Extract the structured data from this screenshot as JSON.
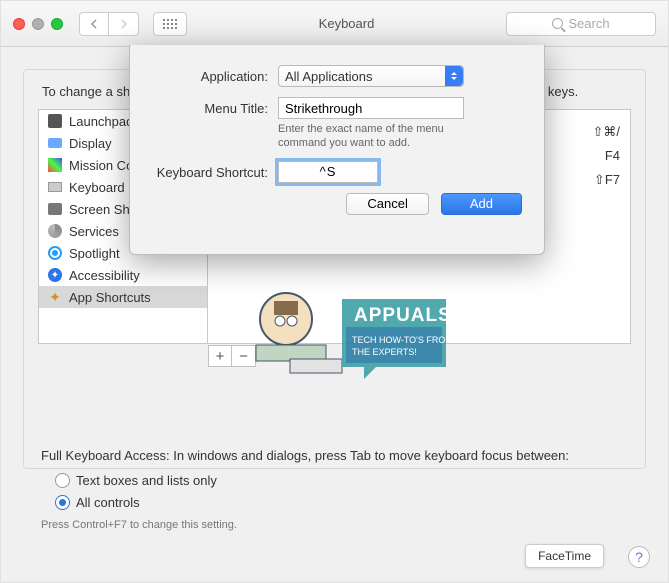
{
  "window": {
    "title": "Keyboard",
    "search_placeholder": "Search"
  },
  "panel": {
    "intro": "To change a shortcut, select it, double-click the key combination, and then type the new keys."
  },
  "sidebar": {
    "items": [
      {
        "name": "launchpad",
        "label": "Launchpad & Dock"
      },
      {
        "name": "display",
        "label": "Display"
      },
      {
        "name": "mission",
        "label": "Mission Control"
      },
      {
        "name": "keyboard",
        "label": "Keyboard"
      },
      {
        "name": "screenshots",
        "label": "Screen Shots"
      },
      {
        "name": "services",
        "label": "Services"
      },
      {
        "name": "spotlight",
        "label": "Spotlight"
      },
      {
        "name": "accessibility",
        "label": "Accessibility"
      },
      {
        "name": "app-shortcuts",
        "label": "App Shortcuts",
        "selected": true
      }
    ]
  },
  "shortcuts_column": {
    "rows": [
      "⇧⌘/",
      "F4",
      "⇧F7"
    ]
  },
  "sheet": {
    "application_label": "Application:",
    "application_value": "All Applications",
    "menu_title_label": "Menu Title:",
    "menu_title_value": "Strikethrough",
    "menu_title_note": "Enter the exact name of the menu command you want to add.",
    "shortcut_label": "Keyboard Shortcut:",
    "shortcut_value": "^S",
    "cancel": "Cancel",
    "add": "Add"
  },
  "fka": {
    "line": "Full Keyboard Access: In windows and dialogs, press Tab to move keyboard focus between:",
    "opt1": "Text boxes and lists only",
    "opt2": "All controls",
    "hint": "Press Control+F7 to change this setting."
  },
  "footer": {
    "facetime": "FaceTime",
    "help": "?"
  },
  "watermark": {
    "brand": "APPUALS",
    "tag1": "TECH HOW-TO'S FROM",
    "tag2": "THE EXPERTS!"
  }
}
